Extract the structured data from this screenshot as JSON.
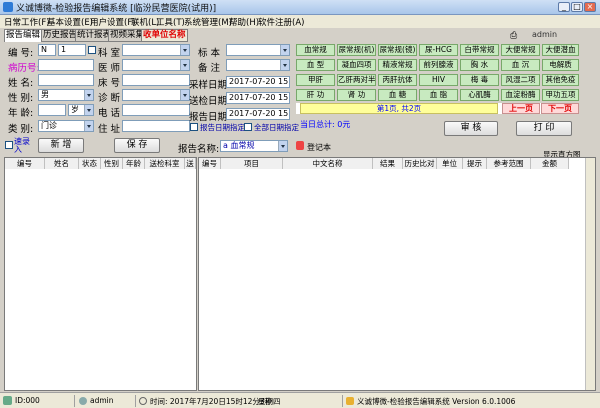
{
  "window": {
    "title": "义诚博微-检验报告编辑系统 [临汾民营医院(试用)]",
    "min": "_",
    "max": "□",
    "close": "×"
  },
  "menus": [
    "日常工作(F)",
    "基本设置(E)",
    "用户设置(F)",
    "联机(L)",
    "工具(T)",
    "系统管理(M)",
    "帮助(H)",
    "软件注册(A)"
  ],
  "tabs": [
    "报告编辑",
    "历史报告",
    "统计报表",
    "视频采集",
    "收单位名称"
  ],
  "user": "admin",
  "form": {
    "no_label": "编 号:",
    "no_prefix": "N",
    "no_value": "1",
    "room_label": "科 室",
    "sample_label": "标 本",
    "remark_label": "备 注",
    "case_label": "病历号:",
    "doctor_label": "医 师",
    "name_label": "姓 名:",
    "bed_label": "床 号",
    "sex_label": "性 别:",
    "sex_value": "男",
    "diag_label": "诊 断",
    "age_label": "年 龄:",
    "age_unit": "岁",
    "phone_label": "电 话",
    "cat_label": "类 别:",
    "cat_value": "门诊",
    "addr_label": "住 址",
    "collect_label": "采样日期",
    "collect_value": "2017-07-20 15:01",
    "send_label": "送检日期",
    "send_value": "2017-07-20 15:01",
    "report_label": "报告日期",
    "report_value": "2017-07-20 15:01",
    "chk_report": "报告日期指定",
    "chk_all": "全部日期指定"
  },
  "items": [
    [
      "血常规",
      "尿常规(机)",
      "尿常规(镜)",
      "尿-HCG",
      "白带常规",
      "大便常规",
      "大便潜血"
    ],
    [
      "血 型",
      "凝血四项",
      "精液常规",
      "前列腺液",
      "胸 水",
      "血 沉",
      "电解质"
    ],
    [
      "甲肝",
      "乙肝两对半",
      "丙肝抗体",
      "HIV",
      "梅 毒",
      "风湿二项",
      "其他免疫"
    ],
    [
      "肝 功",
      "肾 功",
      "血 糖",
      "血 脂",
      "心肌酶",
      "血淀粉酶",
      "甲功五项"
    ]
  ],
  "pager": {
    "info": "第1页, 共2页",
    "prev": "上一页",
    "next": "下一页"
  },
  "today_total": "当日总计: 0元",
  "buttons": {
    "audit": "审 核",
    "print": "打 印",
    "add": "新 增",
    "save": "保 存",
    "notebook": "登记本"
  },
  "quick_entry": "速录入",
  "report_name_label": "报告名称:",
  "report_name_value": "a 血常规",
  "show_grid": "显示直方图",
  "left_cols": [
    "编号",
    "姓名",
    "状态",
    "性别",
    "年龄",
    "送检科室",
    "送"
  ],
  "right_cols": [
    "编号",
    "项目",
    "中文名称",
    "结果",
    "历史比对",
    "单位",
    "提示",
    "参考范围",
    "金额"
  ],
  "status": {
    "id": "ID:000",
    "user": "admin",
    "time": "时间: 2017年7月20日15时12分3秒",
    "week": "星期四",
    "app": "义诚博微-检验报告编辑系统 Version 6.0.1006"
  }
}
